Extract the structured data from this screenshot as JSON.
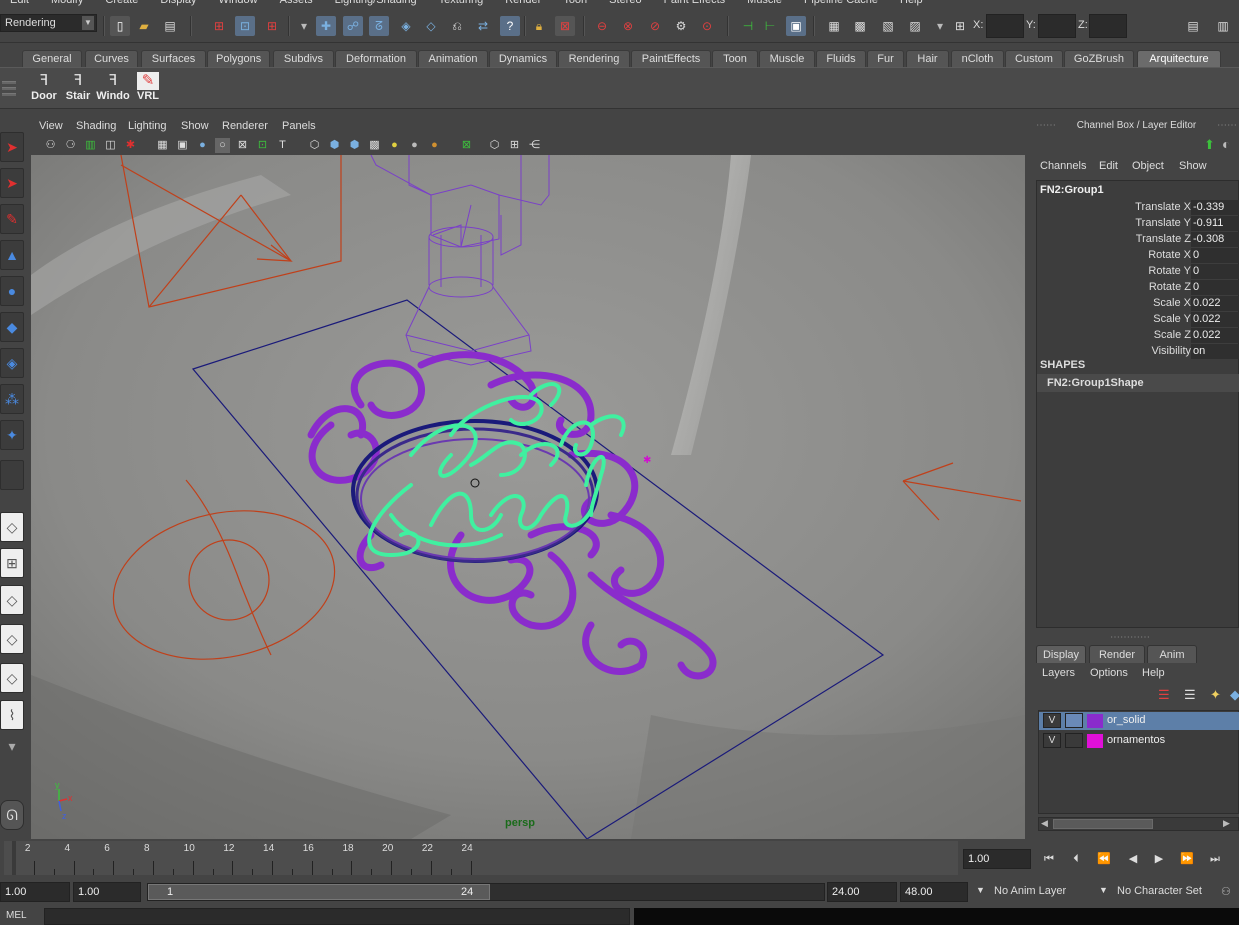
{
  "menubar": {
    "items": [
      "Edit",
      "Modify",
      "Create",
      "Display",
      "Window",
      "Assets",
      "Lighting/Shading",
      "Texturing",
      "Render",
      "Toon",
      "Stereo",
      "Paint Effects",
      "Muscle",
      "Pipeline Cache",
      "Help"
    ]
  },
  "statusline": {
    "mode": "Rendering",
    "x_label": "X:",
    "y_label": "Y:",
    "z_label": "Z:"
  },
  "shelf": {
    "tabs": [
      "General",
      "Curves",
      "Surfaces",
      "Polygons",
      "Subdivs",
      "Deformation",
      "Animation",
      "Dynamics",
      "Rendering",
      "PaintEffects",
      "Toon",
      "Muscle",
      "Fluids",
      "Fur",
      "Hair",
      "nCloth",
      "Custom",
      "GoZBrush",
      "Arquitecture"
    ],
    "active_tab": "Arquitecture",
    "buttons": [
      {
        "label": "Door",
        "icon": "door-icon"
      },
      {
        "label": "Stair",
        "icon": "stair-icon"
      },
      {
        "label": "Windo",
        "icon": "window-icon"
      },
      {
        "label": "VRL",
        "icon": "vrl-icon"
      }
    ]
  },
  "viewport": {
    "menus": [
      "View",
      "Shading",
      "Lighting",
      "Show",
      "Renderer",
      "Panels"
    ],
    "camera": "persp",
    "axis": {
      "x": "x",
      "y": "y",
      "z": "z"
    },
    "colors": {
      "wire_red": "#c0401a",
      "wire_blue": "#1a1a7a",
      "wire_purple": "#7a40c8",
      "ornament_purple": "#8a2ccc",
      "text_green": "#40f0a0"
    }
  },
  "channelbox": {
    "title": "Channel Box / Layer Editor",
    "menus": [
      "Channels",
      "Edit",
      "Object",
      "Show"
    ],
    "object": "FN2:Group1",
    "attributes": [
      {
        "name": "Translate X",
        "value": "-0.339"
      },
      {
        "name": "Translate Y",
        "value": "-0.911"
      },
      {
        "name": "Translate Z",
        "value": "-0.308"
      },
      {
        "name": "Rotate X",
        "value": "0"
      },
      {
        "name": "Rotate Y",
        "value": "0"
      },
      {
        "name": "Rotate Z",
        "value": "0"
      },
      {
        "name": "Scale X",
        "value": "0.022"
      },
      {
        "name": "Scale Y",
        "value": "0.022"
      },
      {
        "name": "Scale Z",
        "value": "0.022"
      },
      {
        "name": "Visibility",
        "value": "on"
      }
    ],
    "shapes_header": "SHAPES",
    "shape": "FN2:Group1Shape"
  },
  "layereditor": {
    "tabs": [
      "Display",
      "Render",
      "Anim"
    ],
    "active_tab": "Display",
    "menus": [
      "Layers",
      "Options",
      "Help"
    ],
    "layers": [
      {
        "visible": "V",
        "name": "or_solid",
        "color": "#8a2ccc",
        "selected": true
      },
      {
        "visible": "V",
        "name": "ornamentos",
        "color": "#e010d8",
        "selected": false
      }
    ]
  },
  "timeslider": {
    "ticks": [
      "2",
      "4",
      "6",
      "8",
      "10",
      "12",
      "14",
      "16",
      "18",
      "20",
      "22",
      "24"
    ],
    "current_frame": "1.00"
  },
  "rangeslider": {
    "start_time": "1.00",
    "playback_start": "1.00",
    "range_start_label": "1",
    "range_end_label": "24",
    "playback_end": "24.00",
    "end_time": "48.00",
    "anim_layer": "No Anim Layer",
    "character_set": "No Character Set"
  },
  "cmdline": {
    "label": "MEL"
  }
}
